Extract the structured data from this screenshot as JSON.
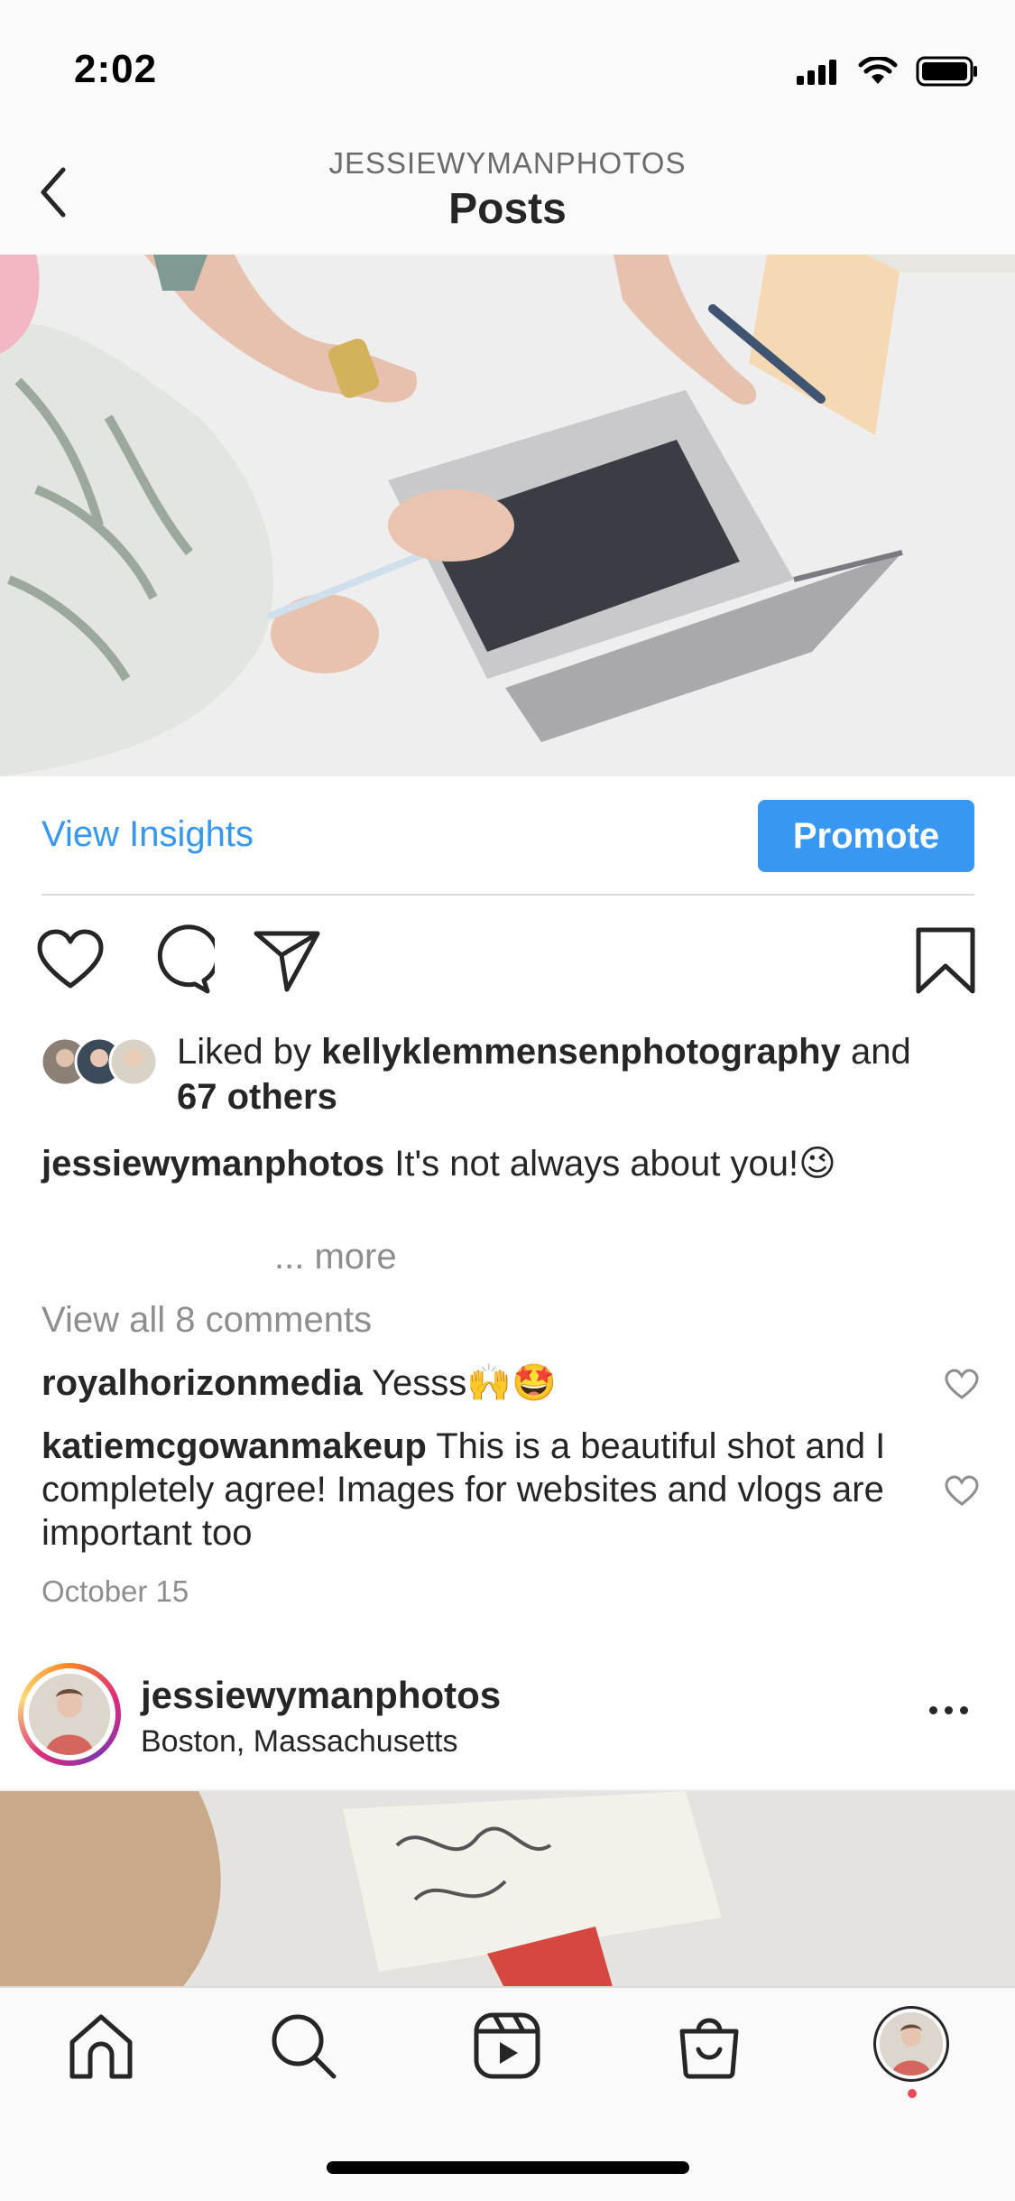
{
  "status_bar": {
    "time": "2:02"
  },
  "header": {
    "username": "JESSIEWYMANPHOTOS",
    "title": "Posts"
  },
  "insights_bar": {
    "view_insights": "View Insights",
    "promote": "Promote"
  },
  "likes": {
    "prefix": "Liked by ",
    "user": "kellyklemmensenphotography",
    "middle": " and",
    "others": "67 others"
  },
  "caption": {
    "user": "jessiewymanphotos",
    "text": " It's not always about you!😉",
    "more": "... more"
  },
  "comments": {
    "view_all": "View all 8 comments",
    "items": [
      {
        "user": "royalhorizonmedia",
        "text": " Yesss🙌🤩"
      },
      {
        "user": "katiemcgowanmakeup",
        "text": " This is a beautiful shot and I completely agree! Images for websites and vlogs are important too"
      }
    ]
  },
  "post_date": "October 15",
  "next_post": {
    "user": "jessiewymanphotos",
    "location": "Boston, Massachusetts"
  },
  "icons": {
    "back": "chevron-left-icon",
    "like": "heart-icon",
    "comment": "comment-icon",
    "share": "send-icon",
    "save": "bookmark-icon",
    "tabs": [
      "home-icon",
      "search-icon",
      "reels-icon",
      "shop-icon",
      "profile-avatar"
    ]
  },
  "colors": {
    "accent": "#3897f0",
    "text": "#262626",
    "muted": "#8e8e8e",
    "badge": "#ed4956"
  }
}
